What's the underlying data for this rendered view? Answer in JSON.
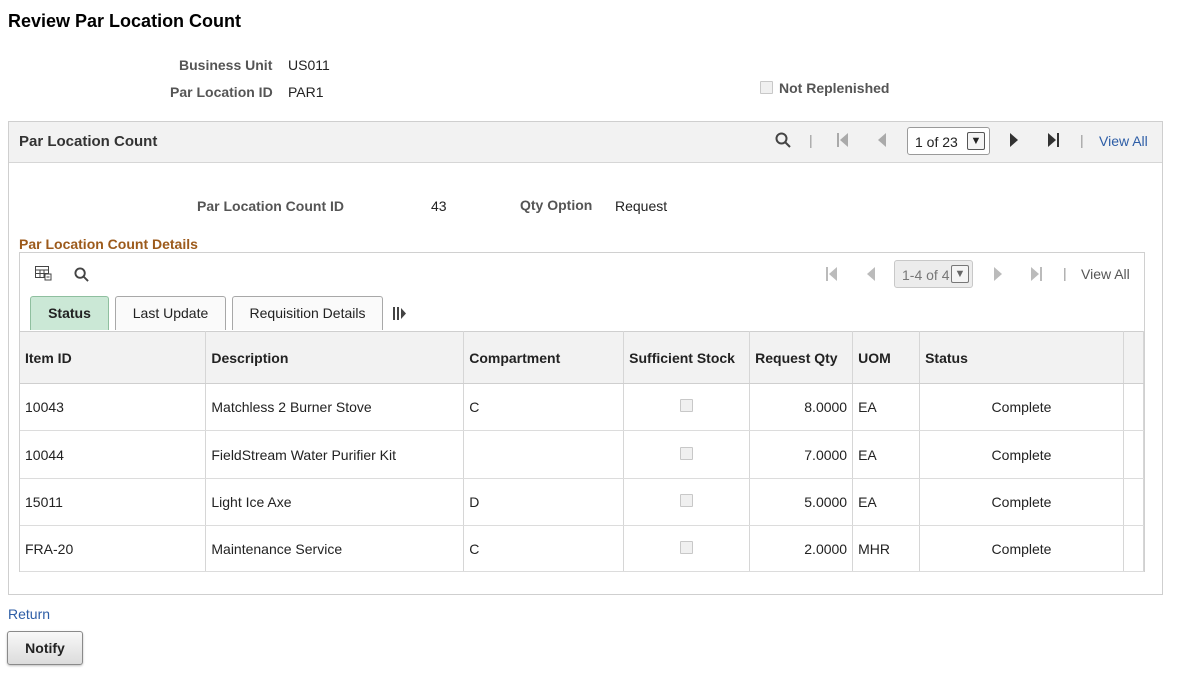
{
  "page": {
    "title": "Review Par Location Count"
  },
  "header": {
    "business_unit_label": "Business Unit",
    "business_unit_value": "US011",
    "par_location_id_label": "Par Location ID",
    "par_location_id_value": "PAR1",
    "not_replenished_label": "Not Replenished",
    "not_replenished_checked": false
  },
  "group": {
    "title": "Par Location Count",
    "search_icon": "search-icon",
    "pager_value": "1 of 23",
    "view_all": "View All",
    "count_id_label": "Par Location Count ID",
    "count_id_value": "43",
    "qty_option_label": "Qty Option",
    "qty_option_value": "Request"
  },
  "details": {
    "title": "Par Location Count Details",
    "pager_value": "1-4 of 4",
    "view_all": "View All",
    "tabs": [
      {
        "label": "Status",
        "active": true
      },
      {
        "label": "Last Update",
        "active": false
      },
      {
        "label": "Requisition Details",
        "active": false
      }
    ],
    "columns": [
      "Item ID",
      "Description",
      "Compartment",
      "Sufficient Stock",
      "Request Qty",
      "UOM",
      "Status"
    ],
    "rows": [
      {
        "item_id": "10043",
        "description": "Matchless 2 Burner Stove",
        "compartment": "C",
        "sufficient_stock": false,
        "request_qty": "8.0000",
        "uom": "EA",
        "status": "Complete"
      },
      {
        "item_id": "10044",
        "description": "FieldStream Water Purifier Kit",
        "compartment": "",
        "sufficient_stock": false,
        "request_qty": "7.0000",
        "uom": "EA",
        "status": "Complete"
      },
      {
        "item_id": "15011",
        "description": "Light Ice Axe",
        "compartment": "D",
        "sufficient_stock": false,
        "request_qty": "5.0000",
        "uom": "EA",
        "status": "Complete"
      },
      {
        "item_id": "FRA-20",
        "description": "Maintenance Service",
        "compartment": "C",
        "sufficient_stock": false,
        "request_qty": "2.0000",
        "uom": "MHR",
        "status": "Complete"
      }
    ]
  },
  "footer": {
    "return_link": "Return",
    "notify_button": "Notify"
  },
  "colors": {
    "link": "#2d5da6",
    "section_title": "#9c5a1b",
    "active_tab": "#cbe8d6"
  }
}
